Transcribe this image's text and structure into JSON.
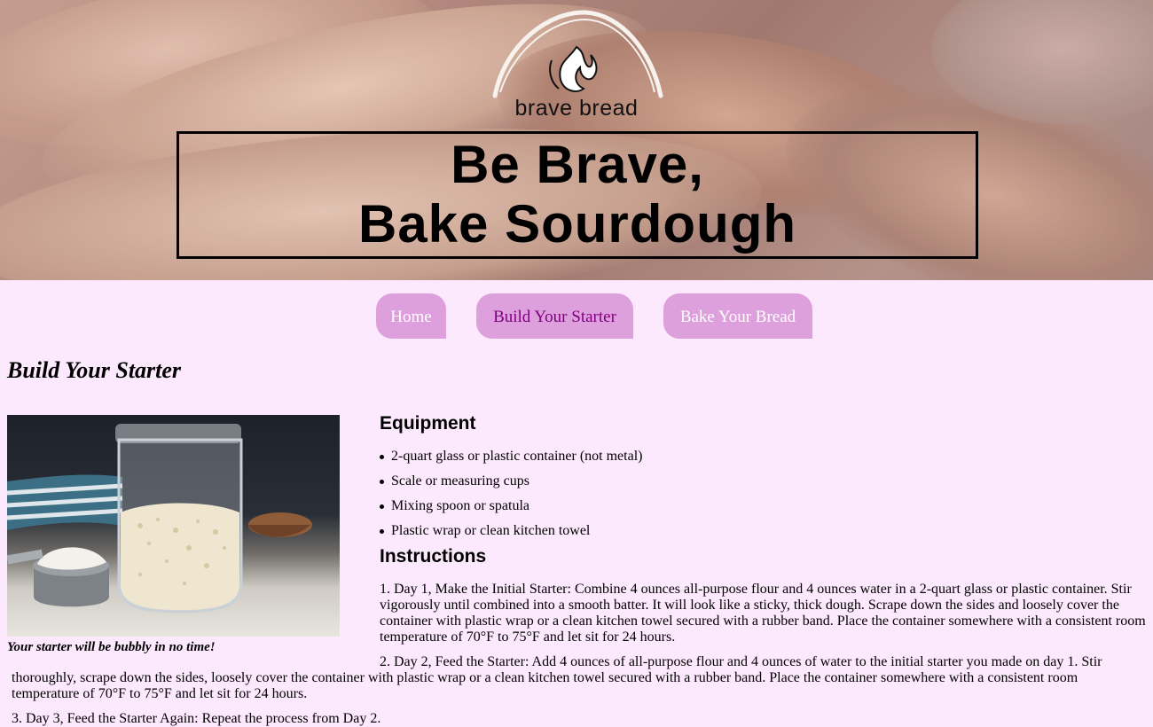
{
  "hero": {
    "logo_text": "brave bread",
    "title_line1": "Be Brave,",
    "title_line2": "Bake Sourdough"
  },
  "nav": [
    {
      "label": "Home",
      "active": false
    },
    {
      "label": "Build Your Starter",
      "active": true
    },
    {
      "label": "Bake Your Bread",
      "active": false
    }
  ],
  "page": {
    "heading": "Build Your Starter",
    "image_caption": "Your starter will be bubbly in no time!"
  },
  "equipment": {
    "title": "Equipment",
    "items": [
      "2-quart glass or plastic container (not metal)",
      "Scale or measuring cups",
      "Mixing spoon or spatula",
      "Plastic wrap or clean kitchen towel"
    ]
  },
  "instructions": {
    "title": "Instructions",
    "steps": [
      "1. Day 1, Make the Initial Starter: Combine 4 ounces all-purpose flour and 4 ounces water in a 2-quart glass or plastic container. Stir vigorously until combined into a smooth batter. It will look like a sticky, thick dough. Scrape down the sides and loosely cover the container with plastic wrap or a clean kitchen towel secured with a rubber band. Place the container somewhere with a consistent room temperature of 70°F to 75°F and let sit for 24 hours.",
      "2. Day 2, Feed the Starter: Add 4 ounces of all-purpose flour and 4 ounces of water to the initial starter you made on day 1. Stir thoroughly, scrape down the sides, loosely cover the container with plastic wrap or a clean kitchen towel secured with a rubber band. Place the container somewhere with a consistent room temperature of 70°F to 75°F and let sit for 24 hours.",
      "3. Day 3, Feed the Starter Again: Repeat the process from Day 2."
    ]
  },
  "colors": {
    "page_background": "#fde9fd",
    "nav_button": "#dda0dd",
    "nav_active_text": "#800080",
    "nav_text": "#ffffff"
  }
}
